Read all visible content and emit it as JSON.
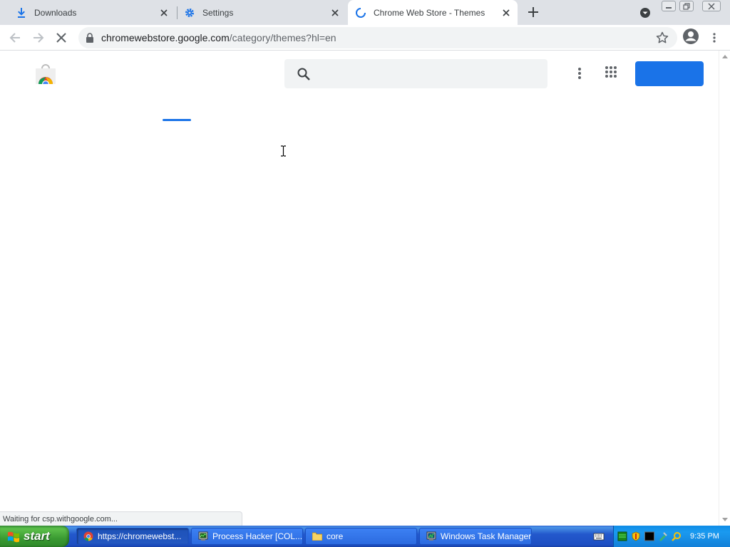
{
  "tabs": [
    {
      "title": "Downloads",
      "icon": "download-icon"
    },
    {
      "title": "Settings",
      "icon": "gear-icon"
    },
    {
      "title": "Chrome Web Store - Themes",
      "icon": "loading-spinner-icon",
      "active": true
    }
  ],
  "address_bar": {
    "host": "chromewebstore.google.com",
    "path": "/category/themes?hl=en"
  },
  "status_bar": {
    "text": "Waiting for csp.withgoogle.com..."
  },
  "taskbar": {
    "start_label": "start",
    "tasks": [
      {
        "label": "https://chromewebst...",
        "icon": "chrome-icon",
        "active": true
      },
      {
        "label": "Process Hacker [COL...",
        "icon": "process-hacker-icon"
      },
      {
        "label": "core",
        "icon": "folder-icon"
      },
      {
        "label": "Windows Task Manager",
        "icon": "task-manager-icon"
      }
    ],
    "clock": "9:35 PM"
  },
  "colors": {
    "accent": "#1a73e8",
    "tabstrip": "#dee1e6",
    "taskbar": "#2358cc",
    "start": "#3a9a32"
  }
}
